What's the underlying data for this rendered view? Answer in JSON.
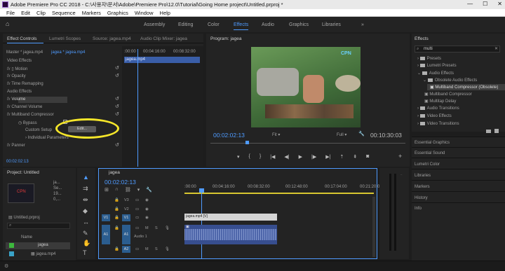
{
  "window": {
    "title": "Adobe Premiere Pro CC 2018 - C:\\사용자\\문서\\Adobe\\Premiere Pro\\12.0\\Tutorial\\Going Home project\\Untitled.prproj *",
    "min": "—",
    "max": "☐",
    "close": "✕"
  },
  "menu": [
    "File",
    "Edit",
    "Clip",
    "Sequence",
    "Markers",
    "Graphics",
    "Window",
    "Help"
  ],
  "workspaces": [
    "Assembly",
    "Editing",
    "Color",
    "Effects",
    "Audio",
    "Graphics",
    "Libraries"
  ],
  "active_workspace": "Effects",
  "left_panel": {
    "tabs": [
      "Effect Controls",
      "Lumetri Scopes",
      "Source: jagea.mp4",
      "Audio Clip Mixer: jagea"
    ],
    "master_label": "Master * jagea.mp4",
    "sequence_label": "jagea * jagea.mp4",
    "mini_time_start": ":00:00",
    "mini_time_mid": "00:04:16:00",
    "mini_time_end": "00:08:32:00",
    "clip_label": "jagea.mp4",
    "video_effects": "Video Effects",
    "motion": "Motion",
    "opacity": "Opacity",
    "time_remapping": "Time Remapping",
    "audio_effects": "Audio Effects",
    "volume": "Volume",
    "channel_volume": "Channel Volume",
    "multiband": "Multiband Compressor",
    "bypass": "Bypass",
    "custom_setup": "Custom Setup",
    "individual_params": "Individual Parameters",
    "panner": "Panner",
    "edit_button": "Edit...",
    "timecode": "00:02:02:13",
    "fx": "fx"
  },
  "program": {
    "tab": "Program: jagea",
    "timecode": "00:02:02:13",
    "fit": "Fit",
    "full": "Full",
    "duration": "00:10:30:03",
    "logo": "CPN"
  },
  "project": {
    "tab": "Project: Untitled",
    "thumb_name": "ja...",
    "thumb_meta1": "Se...",
    "thumb_meta2": "19...",
    "thumb_meta3": "0,...",
    "proj_file": "Untitled.prproj",
    "name_header": "Name",
    "items": [
      "jagea",
      "jagea.mp4"
    ]
  },
  "timeline": {
    "tab": "jagea",
    "timecode": "00:02:02:13",
    "ruler": [
      ":00:00",
      "00:04:16:00",
      "00:08:32:00",
      "00:12:48:00",
      "00:17:04:00",
      "00:21:20:00"
    ],
    "tracks_v": [
      "V3",
      "V2",
      "V1"
    ],
    "tracks_a": [
      "A1",
      "A2"
    ],
    "v1_src": "V1",
    "a1_src": "A1",
    "audio_label": "Audio 1",
    "video_clip": "jagea.mp4 [V]"
  },
  "effects": {
    "title": "Effects",
    "search": "multi",
    "tree": [
      {
        "label": "Presets",
        "level": 0
      },
      {
        "label": "Lumetri Presets",
        "level": 0
      },
      {
        "label": "Audio Effects",
        "level": 0
      },
      {
        "label": "Obsolete Audio Effects",
        "level": 1
      },
      {
        "label": "Multiband Compressor (Obsolete)",
        "level": 2
      },
      {
        "label": "Multiband Compressor",
        "level": 1
      },
      {
        "label": "Multitap Delay",
        "level": 1
      },
      {
        "label": "Audio Transitions",
        "level": 0
      },
      {
        "label": "Video Effects",
        "level": 0
      },
      {
        "label": "Video Transitions",
        "level": 0
      }
    ],
    "panels": [
      "Essential Graphics",
      "Essential Sound",
      "Lumetri Color",
      "Libraries",
      "Markers",
      "History",
      "Info"
    ]
  },
  "colors": {
    "accent": "#4f9bff",
    "highlight": "#f5e62a",
    "clip_audio": "#374e8f",
    "clip_video": "#d5d5d5"
  }
}
